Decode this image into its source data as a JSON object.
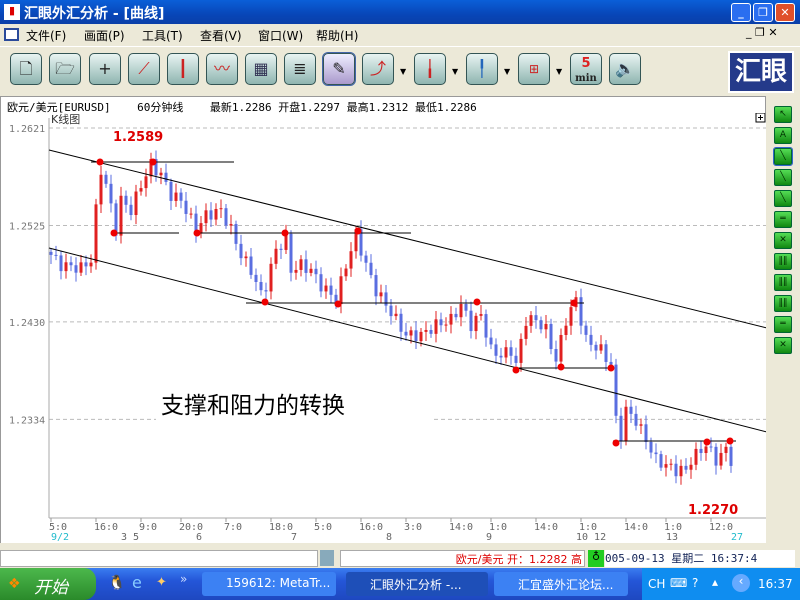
{
  "window": {
    "title": "汇眼外汇分析 - [曲线]",
    "minimize": "_",
    "restore": "❐",
    "close": "✕"
  },
  "menu": [
    {
      "label": "文件(F)"
    },
    {
      "label": "画面(P)"
    },
    {
      "label": "工具(T)"
    },
    {
      "label": "查看(V)"
    },
    {
      "label": "窗口(W)"
    },
    {
      "label": "帮助(H)"
    }
  ],
  "toolbar": {
    "logo": "汇眼",
    "five_min_top": "5",
    "five_min_bottom": "min"
  },
  "info": {
    "symbol": "欧元/美元[EURUSD]",
    "period": "60分钟线",
    "latest": "最新1.2286",
    "open": "开盘1.2297",
    "high": "最高1.2312",
    "low": "最低1.2286"
  },
  "chart_data": {
    "type": "candlestick",
    "title": "K线图",
    "ylim": [
      1.223,
      1.264
    ],
    "y_ticks": [
      "1.2621",
      "1.2525",
      "1.2430",
      "1.2334"
    ],
    "y_tick_values": [
      1.2621,
      1.2525,
      1.243,
      1.2334
    ],
    "x_ticks": [
      "5:0",
      "16:0",
      "9:0",
      "20:0",
      "7:0",
      "18:0",
      "5:0",
      "16:0",
      "3:0",
      "14:0",
      "1:0",
      "14:0",
      "1:0",
      "14:0",
      "1:0",
      "12:0"
    ],
    "x_tick_bars": [
      0,
      9,
      18,
      26,
      35,
      44,
      53,
      62,
      71,
      80,
      88,
      97,
      106,
      115,
      123,
      132
    ],
    "date_labels": [
      "9/2",
      "3 5",
      "6",
      "7",
      "8",
      "9",
      "10 12",
      "13",
      "27"
    ],
    "date_label_bars": [
      0,
      14,
      29,
      48,
      67,
      87,
      105,
      123,
      136
    ],
    "close_keypoints": [
      [
        0,
        1.2496
      ],
      [
        2,
        1.2486
      ],
      [
        6,
        1.2483
      ],
      [
        8,
        1.2491
      ],
      [
        9,
        1.254
      ],
      [
        10,
        1.258
      ],
      [
        11,
        1.2565
      ],
      [
        13,
        1.2521
      ],
      [
        14,
        1.255
      ],
      [
        16,
        1.254
      ],
      [
        18,
        1.2565
      ],
      [
        20,
        1.2585
      ],
      [
        22,
        1.2575
      ],
      [
        24,
        1.2555
      ],
      [
        26,
        1.255
      ],
      [
        29,
        1.2521
      ],
      [
        31,
        1.2535
      ],
      [
        34,
        1.254
      ],
      [
        36,
        1.2521
      ],
      [
        38,
        1.2496
      ],
      [
        40,
        1.2481
      ],
      [
        42,
        1.2457
      ],
      [
        43,
        1.2466
      ],
      [
        45,
        1.2501
      ],
      [
        47,
        1.2511
      ],
      [
        48,
        1.2481
      ],
      [
        50,
        1.2486
      ],
      [
        52,
        1.2481
      ],
      [
        54,
        1.2466
      ],
      [
        57,
        1.2452
      ],
      [
        59,
        1.2486
      ],
      [
        61,
        1.2516
      ],
      [
        63,
        1.2486
      ],
      [
        65,
        1.2461
      ],
      [
        67,
        1.2447
      ],
      [
        69,
        1.2432
      ],
      [
        71,
        1.2417
      ],
      [
        74,
        1.2417
      ],
      [
        77,
        1.2427
      ],
      [
        80,
        1.2432
      ],
      [
        82,
        1.2447
      ],
      [
        84,
        1.2427
      ],
      [
        86,
        1.2437
      ],
      [
        88,
        1.2402
      ],
      [
        90,
        1.2397
      ],
      [
        92,
        1.2402
      ],
      [
        93,
        1.2388
      ],
      [
        95,
        1.2432
      ],
      [
        97,
        1.2432
      ],
      [
        99,
        1.2422
      ],
      [
        101,
        1.2392
      ],
      [
        103,
        1.2432
      ],
      [
        105,
        1.2452
      ],
      [
        107,
        1.2412
      ],
      [
        110,
        1.2402
      ],
      [
        112,
        1.2388
      ],
      [
        113,
        1.2333
      ],
      [
        114,
        1.2319
      ],
      [
        115,
        1.2343
      ],
      [
        117,
        1.2333
      ],
      [
        119,
        1.2314
      ],
      [
        121,
        1.2294
      ],
      [
        123,
        1.2289
      ],
      [
        125,
        1.2284
      ],
      [
        127,
        1.2284
      ],
      [
        128,
        1.2294
      ],
      [
        130,
        1.2304
      ],
      [
        131,
        1.2309
      ],
      [
        133,
        1.2294
      ],
      [
        135,
        1.2304
      ],
      [
        136,
        1.2294
      ]
    ],
    "annotations": {
      "high_label": "1.2589",
      "low_label": "1.2270",
      "caption": "支撑和阻力的转换"
    }
  },
  "status": {
    "quote": "欧元/美元 开：1.2282 高",
    "datetime": "005-09-13 星期二 16:37:4"
  },
  "taskbar": {
    "start": "开始",
    "tasks": [
      "159612: MetaTr...",
      "汇眼外汇分析 -...",
      "汇宜盛外汇论坛..."
    ],
    "lang": "CH",
    "clock": "16:37"
  }
}
